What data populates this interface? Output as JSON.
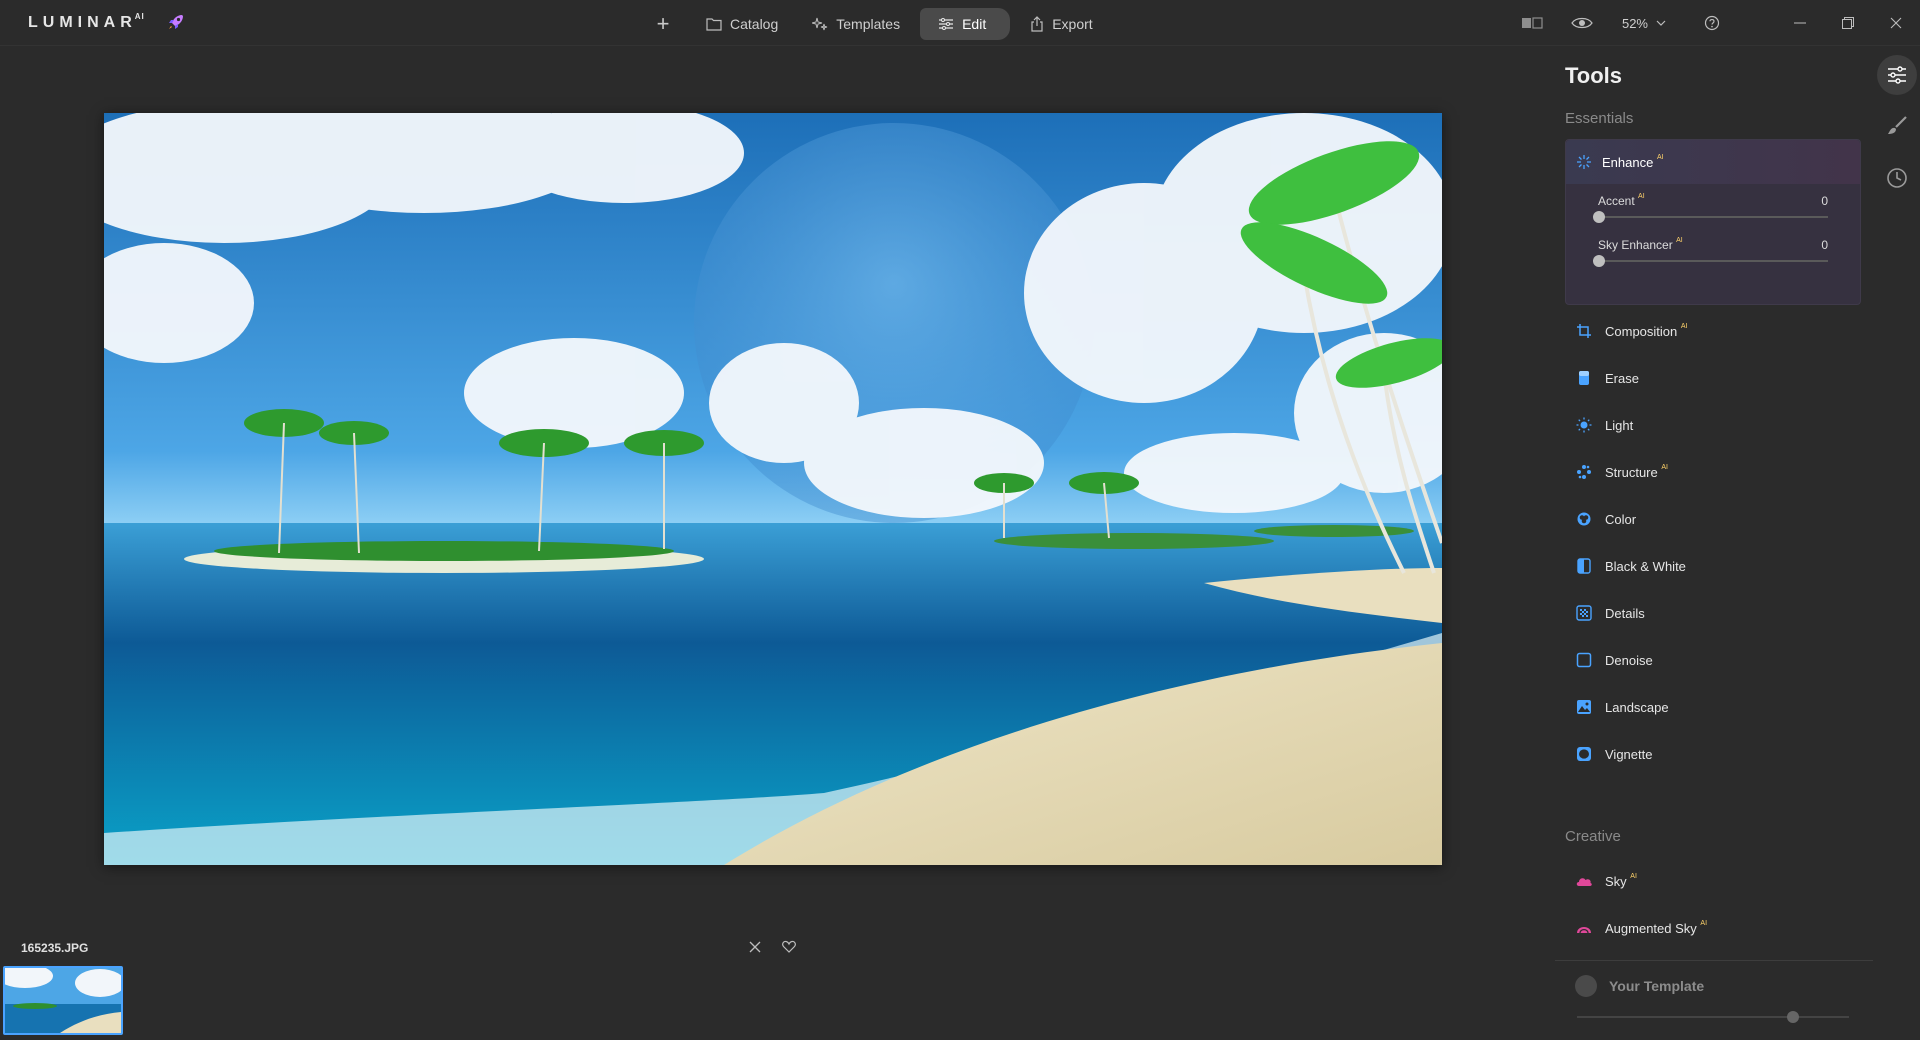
{
  "app": {
    "logo_text": "LUMINAR",
    "logo_suffix": "AI"
  },
  "nav": {
    "items": [
      {
        "label": "Catalog",
        "icon": "folder-icon"
      },
      {
        "label": "Templates",
        "icon": "sparkle-icon"
      },
      {
        "label": "Edit",
        "icon": "sliders-icon",
        "active": true
      },
      {
        "label": "Export",
        "icon": "share-icon"
      }
    ]
  },
  "topright": {
    "zoom": "52%"
  },
  "filmstrip": {
    "filename": "165235.JPG"
  },
  "panel": {
    "title": "Tools",
    "essentials_label": "Essentials",
    "creative_label": "Creative",
    "enhance": {
      "label": "Enhance",
      "ai": "AI",
      "sliders": [
        {
          "label": "Accent",
          "ai": "AI",
          "value": "0"
        },
        {
          "label": "Sky Enhancer",
          "ai": "AI",
          "value": "0"
        }
      ]
    },
    "tools": [
      {
        "label": "Composition",
        "ai": "AI",
        "icon": "crop-icon",
        "color": "#4aa3ff"
      },
      {
        "label": "Erase",
        "ai": "",
        "icon": "eraser-icon",
        "color": "#4aa3ff"
      },
      {
        "label": "Light",
        "ai": "",
        "icon": "sun-icon",
        "color": "#4aa3ff"
      },
      {
        "label": "Structure",
        "ai": "AI",
        "icon": "structure-icon",
        "color": "#4aa3ff"
      },
      {
        "label": "Color",
        "ai": "",
        "icon": "color-icon",
        "color": "#4aa3ff"
      },
      {
        "label": "Black & White",
        "ai": "",
        "icon": "bw-icon",
        "color": "#4aa3ff"
      },
      {
        "label": "Details",
        "ai": "",
        "icon": "details-icon",
        "color": "#4aa3ff"
      },
      {
        "label": "Denoise",
        "ai": "",
        "icon": "denoise-icon",
        "color": "#4aa3ff"
      },
      {
        "label": "Landscape",
        "ai": "",
        "icon": "landscape-icon",
        "color": "#4aa3ff"
      },
      {
        "label": "Vignette",
        "ai": "",
        "icon": "vignette-icon",
        "color": "#4aa3ff"
      }
    ],
    "creative_tools": [
      {
        "label": "Sky",
        "ai": "AI",
        "icon": "cloud-icon",
        "color": "#e0489a"
      },
      {
        "label": "Augmented Sky",
        "ai": "AI",
        "icon": "half-sun-icon",
        "color": "#e0489a"
      }
    ],
    "your_template": "Your Template"
  },
  "colors": {
    "accent": "#4aa3ff",
    "creative": "#e0489a",
    "ai_badge": "#ffd36a"
  }
}
